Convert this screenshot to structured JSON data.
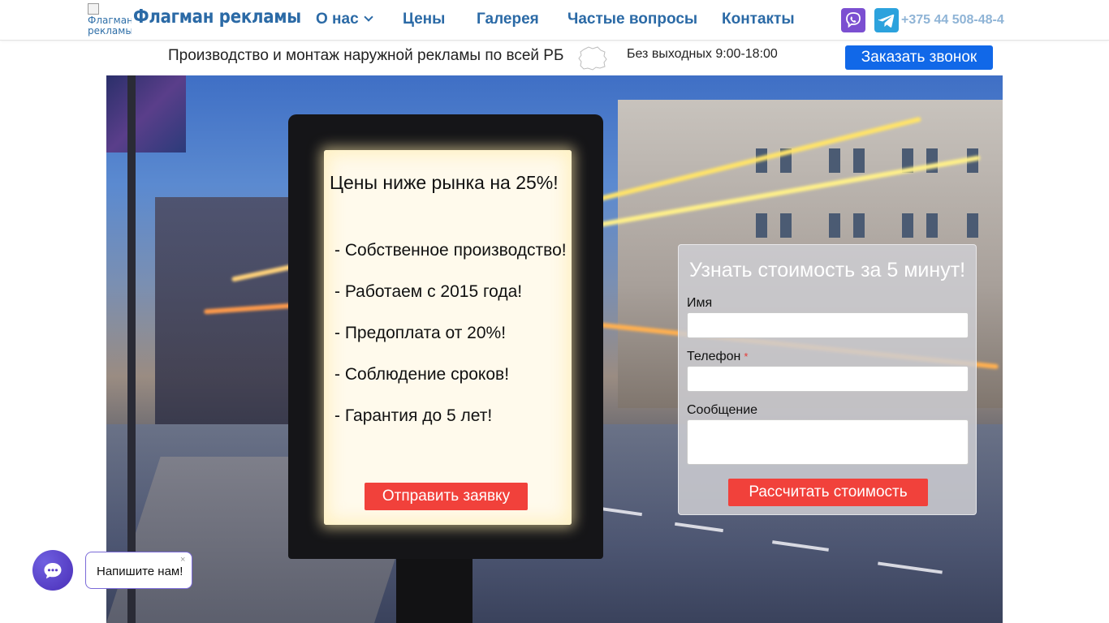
{
  "header": {
    "logo_alt": "Флагман рекламы",
    "logo_text": "Флагман рекламы",
    "nav": [
      {
        "label": "О нас",
        "has_dropdown": true
      },
      {
        "label": "Цены"
      },
      {
        "label": "Галерея"
      },
      {
        "label": "Частые вопросы"
      },
      {
        "label": "Контакты"
      }
    ],
    "messengers": [
      {
        "icon": "viber-icon",
        "color": "#7b4fd1"
      },
      {
        "icon": "telegram-icon",
        "color": "#2ca2dd"
      }
    ],
    "phone": "+375 44 508-48-4"
  },
  "subbar": {
    "tagline": "Производство и монтаж наружной рекламы по всей РБ",
    "map_icon": "belarus-map-icon",
    "hours": "Без выходных 9:00-18:00",
    "call_button": "Заказать звонок"
  },
  "hero": {
    "billboard": {
      "title": "Цены ниже рынка на 25%!",
      "points": [
        "- Собственное производство!",
        "- Работаем с 2015 года!",
        "- Предоплата от 20%!",
        "- Соблюдение сроков!",
        "- Гарантия до 5 лет!"
      ],
      "button": "Отправить заявку"
    },
    "form": {
      "title": "Узнать стоимость за 5 минут!",
      "name_label": "Имя",
      "name_value": "",
      "phone_label": "Телефон",
      "phone_required_mark": "*",
      "phone_value": "",
      "message_label": "Сообщение",
      "message_value": "",
      "submit": "Рассчитать стоимость"
    }
  },
  "chat": {
    "prompt": "Напишите нам!",
    "close": "×"
  },
  "colors": {
    "brand_blue": "#2b6aa6",
    "cta_blue": "#1168e8",
    "cta_red": "#f1413b",
    "chat_purple": "#5a3fc8"
  }
}
